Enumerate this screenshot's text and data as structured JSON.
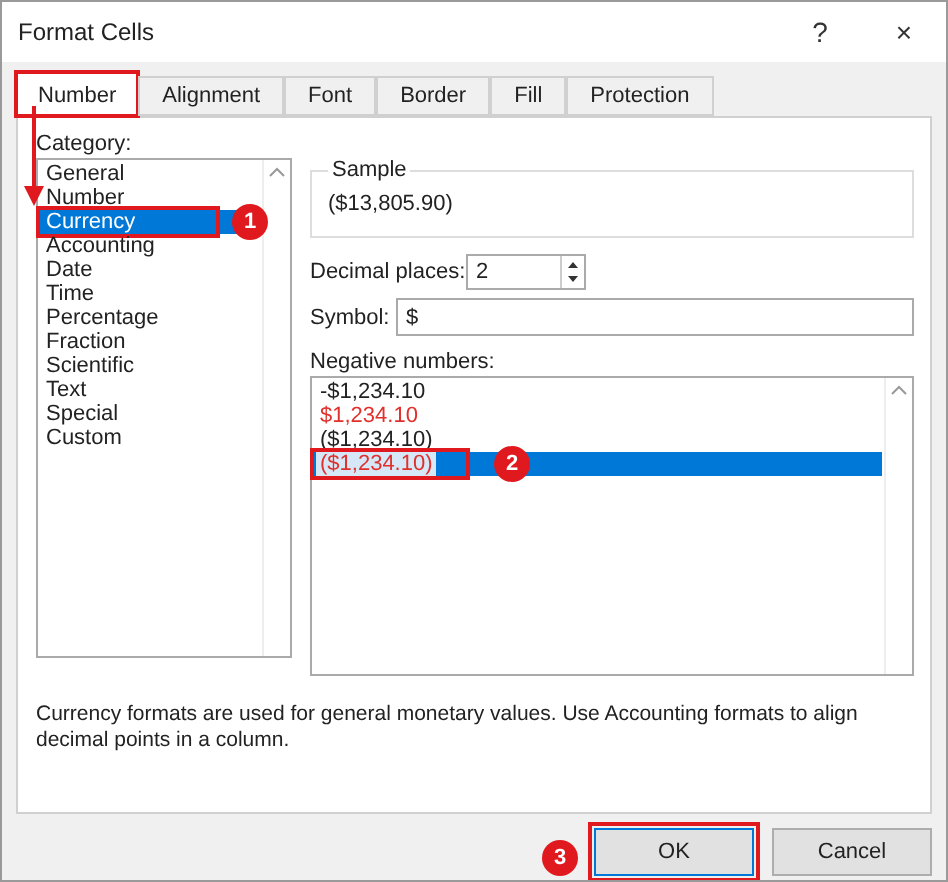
{
  "window": {
    "title": "Format Cells",
    "help": "?",
    "close": "×"
  },
  "tabs": [
    {
      "label": "Number",
      "selected": true,
      "highlighted": true
    },
    {
      "label": "Alignment",
      "selected": false,
      "highlighted": false
    },
    {
      "label": "Font",
      "selected": false,
      "highlighted": false
    },
    {
      "label": "Border",
      "selected": false,
      "highlighted": false
    },
    {
      "label": "Fill",
      "selected": false,
      "highlighted": false
    },
    {
      "label": "Protection",
      "selected": false,
      "highlighted": false
    }
  ],
  "category": {
    "label": "Category:",
    "items": [
      {
        "label": "General",
        "selected": false,
        "highlighted": false
      },
      {
        "label": "Number",
        "selected": false,
        "highlighted": false
      },
      {
        "label": "Currency",
        "selected": true,
        "highlighted": true,
        "step": "1"
      },
      {
        "label": "Accounting",
        "selected": false,
        "highlighted": false
      },
      {
        "label": "Date",
        "selected": false,
        "highlighted": false
      },
      {
        "label": "Time",
        "selected": false,
        "highlighted": false
      },
      {
        "label": "Percentage",
        "selected": false,
        "highlighted": false
      },
      {
        "label": "Fraction",
        "selected": false,
        "highlighted": false
      },
      {
        "label": "Scientific",
        "selected": false,
        "highlighted": false
      },
      {
        "label": "Text",
        "selected": false,
        "highlighted": false
      },
      {
        "label": "Special",
        "selected": false,
        "highlighted": false
      },
      {
        "label": "Custom",
        "selected": false,
        "highlighted": false
      }
    ]
  },
  "arrow_from_tab_to_category": true,
  "sample": {
    "label": "Sample",
    "value": "($13,805.90)"
  },
  "decimal_places": {
    "label": "Decimal places:",
    "value": "2"
  },
  "symbol": {
    "label": "Symbol:",
    "value": "$"
  },
  "negative_numbers": {
    "label": "Negative numbers:",
    "items": [
      {
        "text": "-$1,234.10",
        "color": "#222222",
        "selected": false,
        "highlighted": false
      },
      {
        "text": "$1,234.10",
        "color": "#e0302c",
        "selected": false,
        "highlighted": false
      },
      {
        "text": "($1,234.10)",
        "color": "#222222",
        "selected": false,
        "highlighted": false
      },
      {
        "text": "($1,234.10)",
        "color": "#e0302c",
        "selected": true,
        "highlighted": true,
        "step": "2"
      }
    ]
  },
  "description": "Currency formats are used for general monetary values.  Use Accounting formats to align decimal points in a column.",
  "buttons": [
    {
      "label": "OK",
      "default": true,
      "highlighted": true,
      "step": "3"
    },
    {
      "label": "Cancel",
      "default": false,
      "highlighted": false
    }
  ]
}
